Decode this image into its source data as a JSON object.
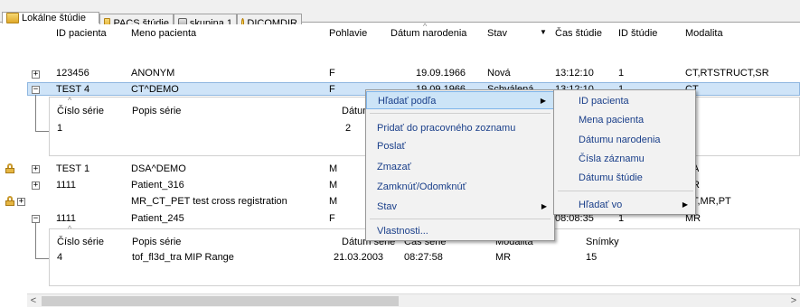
{
  "tabs": [
    {
      "label": "Lokálne štúdie",
      "icon": "folder-icon",
      "active": true
    },
    {
      "label": "PACS štúdie",
      "icon": "folder-icon",
      "active": false
    },
    {
      "label": "skupina 1",
      "icon": "disk-icon",
      "active": false
    },
    {
      "label": "DICOMDIR",
      "icon": "dicom-icon",
      "active": false
    }
  ],
  "columns": {
    "patient_id": "ID pacienta",
    "patient_name": "Meno pacienta",
    "sex": "Pohlavie",
    "birth_date": "Dátum narodenia",
    "state": "Stav",
    "study_time": "Čas štúdie",
    "study_id": "ID štúdie",
    "modality": "Modalita"
  },
  "rows": [
    {
      "patient_id": "123456",
      "patient_name": "ANONYM",
      "sex": "F",
      "birth_date": "19.09.1966",
      "state": "Nová",
      "study_time": "13:12:10",
      "study_id": "1",
      "modality": "CT,RTSTRUCT,SR"
    },
    {
      "patient_id": "TEST 4",
      "patient_name": "CT^DEMO",
      "sex": "F",
      "birth_date": "19.09.1966",
      "state": "Schválená",
      "study_time": "13:12:10",
      "study_id": "1",
      "modality": "CT"
    },
    {
      "patient_id": "TEST 1",
      "patient_name": "DSA^DEMO",
      "sex": "M",
      "birth_date": "",
      "state": "",
      "study_time": "",
      "study_id": "",
      "modality": "A"
    },
    {
      "patient_id": "1111",
      "patient_name": "Patient_316",
      "sex": "M",
      "birth_date": "",
      "state": "",
      "study_time": "",
      "study_id": "",
      "modality": "R"
    },
    {
      "patient_id": "",
      "patient_name": "MR_CT_PET test cross registration",
      "sex": "M",
      "birth_date": "",
      "state": "",
      "study_time": "",
      "study_id": "",
      "modality": "T,MR,PT"
    },
    {
      "patient_id": "1111",
      "patient_name": "Patient_245",
      "sex": "F",
      "birth_date": "",
      "state": "",
      "study_time": "08:08:35",
      "study_id": "1",
      "modality": "MR"
    }
  ],
  "series_columns": {
    "series_no": "Číslo série",
    "series_desc": "Popis série",
    "series_date": "Dátum série",
    "series_time": "Čas série",
    "modality": "Modalita",
    "images": "Snímky"
  },
  "series_1": [
    {
      "series_no": "1",
      "series_desc": "",
      "series_date": "2"
    }
  ],
  "series_2": [
    {
      "series_no": "4",
      "series_desc": "tof_fl3d_tra MIP Range",
      "series_date": "21.03.2003",
      "series_time": "08:27:58",
      "modality": "MR",
      "images": "15"
    }
  ],
  "context_menu": {
    "search_by": "Hľadať podľa",
    "add_worklist": "Pridať do pracovného zoznamu",
    "send": "Poslať",
    "delete": "Zmazať",
    "lock_unlock": "Zamknúť/Odomknúť",
    "state": "Stav",
    "properties": "Vlastnosti..."
  },
  "submenu": {
    "patient_id": "ID pacienta",
    "patient_names": "Mena pacienta",
    "birth_date": "Dátumu narodenia",
    "record_numbers": "Čísla záznamu",
    "study_date": "Dátumu štúdie",
    "search_in": "Hľadať vo"
  },
  "scroll": {
    "left": "<",
    "right": ">"
  }
}
